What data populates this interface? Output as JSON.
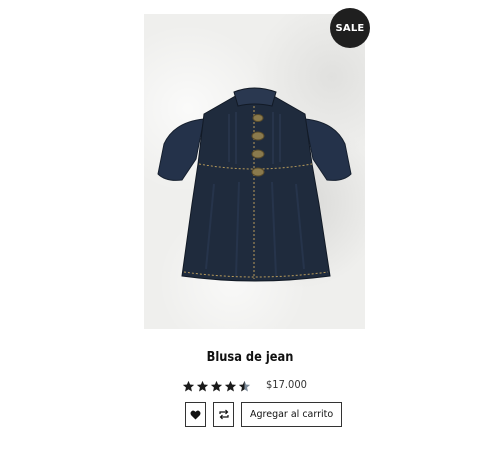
{
  "product": {
    "badge": "SALE",
    "title": "Blusa de jean",
    "price": "$17.000",
    "rating": 4.5,
    "rating_max": 5,
    "image_icon": "denim-blouse-image"
  },
  "actions": {
    "wishlist_icon": "heart-icon",
    "compare_icon": "repeat-icon",
    "cart_label": "Agregar al carrito"
  },
  "colors": {
    "star_filled": "#1a1a1a",
    "star_empty": "#7b8a99",
    "badge_bg": "#1f1f1f",
    "denim": "#1f2b3d"
  }
}
